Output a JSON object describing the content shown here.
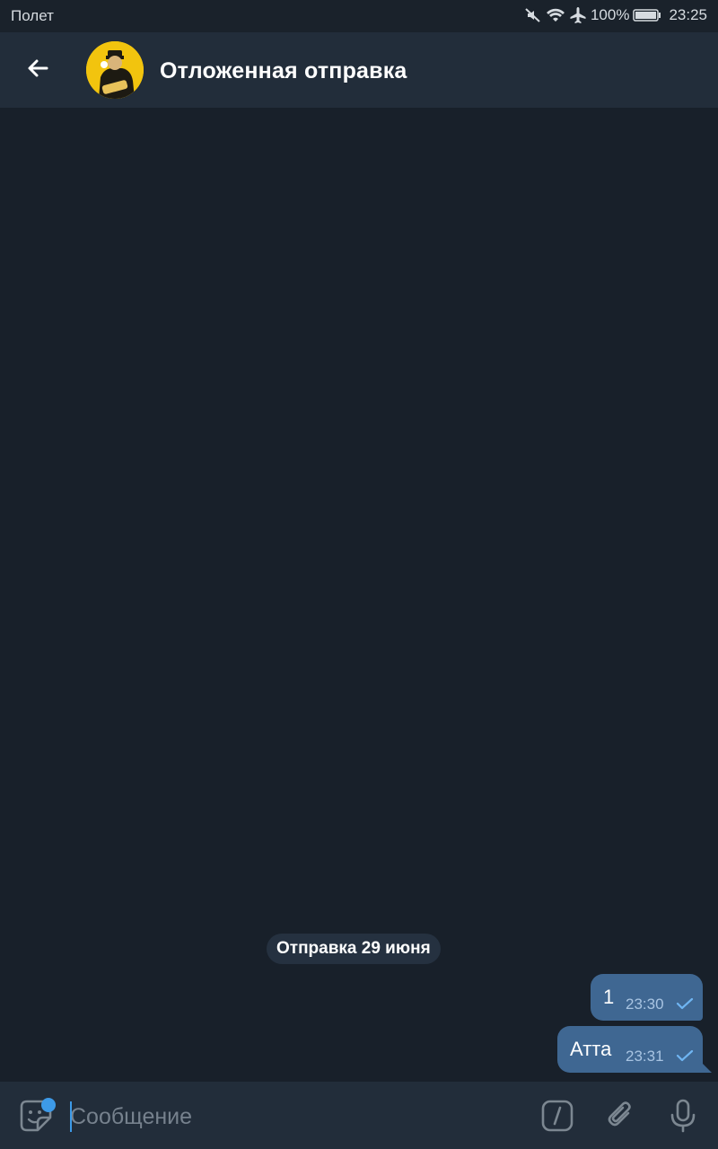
{
  "status_bar": {
    "carrier": "Полет",
    "battery": "100%",
    "time": "23:25"
  },
  "header": {
    "title": "Отложенная отправка"
  },
  "chat": {
    "date_label": "Отправка 29 июня",
    "messages": [
      {
        "text": "1",
        "time": "23:30"
      },
      {
        "text": "Атта",
        "time": "23:31"
      }
    ]
  },
  "composer": {
    "placeholder": "Сообщение"
  },
  "colors": {
    "background": "#18202a",
    "header": "#222d3a",
    "bubble": "#3f6792",
    "accent": "#3d9ae8"
  },
  "icons": {
    "back": "arrow-left-icon",
    "emoji": "sticker-icon",
    "commands": "slash-command-icon",
    "attach": "paperclip-icon",
    "mic": "microphone-icon"
  }
}
